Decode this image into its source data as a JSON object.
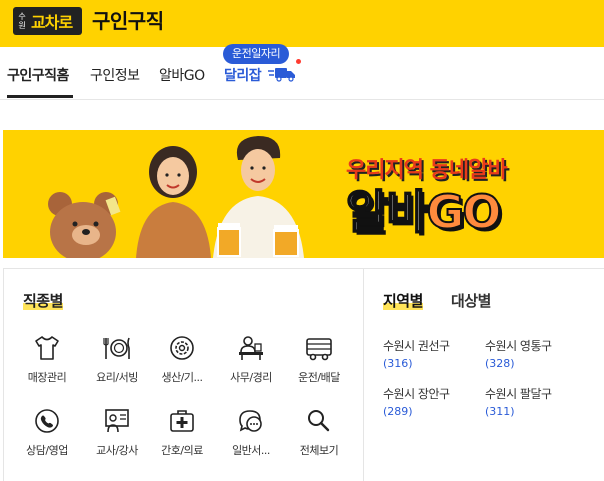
{
  "header": {
    "logo_small": "수원",
    "logo_main": "교차로",
    "title": "구인구직"
  },
  "nav": {
    "items": [
      {
        "label": "구인구직홈",
        "active": true
      },
      {
        "label": "구인정보",
        "active": false
      },
      {
        "label": "알바GO",
        "active": false
      }
    ],
    "driver_badge": "운전일자리",
    "driver_label": "달리잡"
  },
  "banner": {
    "headline": "우리지역 동네알바",
    "brand_part1": "알바",
    "brand_part2": "GO"
  },
  "categories": {
    "title": "직종별",
    "items": [
      {
        "label": "매장관리",
        "icon": "shirt-icon"
      },
      {
        "label": "요리/서빙",
        "icon": "dining-icon"
      },
      {
        "label": "생산/기...",
        "icon": "gear-icon"
      },
      {
        "label": "사무/경리",
        "icon": "office-worker-icon"
      },
      {
        "label": "운전/배달",
        "icon": "truck-icon"
      },
      {
        "label": "상담/영업",
        "icon": "phone-icon"
      },
      {
        "label": "교사/강사",
        "icon": "teacher-icon"
      },
      {
        "label": "간호/의료",
        "icon": "medical-kit-icon"
      },
      {
        "label": "일반서...",
        "icon": "chat-bubble-icon"
      },
      {
        "label": "전체보기",
        "icon": "search-icon"
      }
    ]
  },
  "regions": {
    "tabs": [
      {
        "label": "지역별",
        "active": true
      },
      {
        "label": "대상별",
        "active": false
      }
    ],
    "items": [
      {
        "name": "수원시 권선구",
        "count": "(316)"
      },
      {
        "name": "수원시 영통구",
        "count": "(328)"
      },
      {
        "name": "수원시 장안구",
        "count": "(289)"
      },
      {
        "name": "수원시 팔달구",
        "count": "(311)"
      }
    ]
  },
  "colors": {
    "brand_yellow": "#ffd200",
    "link_blue": "#2a5bd7",
    "headline_red": "#e83a1b",
    "brand_orange": "#ff8a3d"
  }
}
